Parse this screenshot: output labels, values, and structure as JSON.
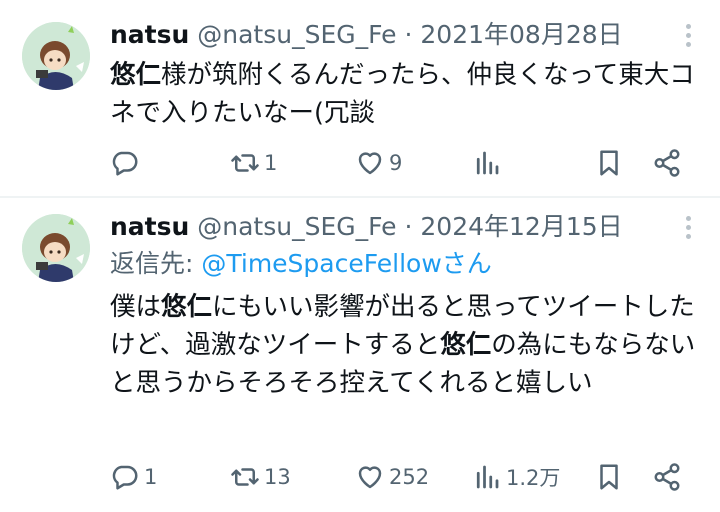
{
  "tweets": [
    {
      "author_name": "natsu",
      "handle": "@natsu_SEG_Fe",
      "separator": "·",
      "date": "2021年08月28日",
      "reply_to": null,
      "body_segments": [
        {
          "text": "悠仁",
          "bold": true
        },
        {
          "text": "様が筑附くるんだったら、仲良くなって東大コネで入りたいなー(冗談",
          "bold": false
        }
      ],
      "replies": "",
      "reposts": "1",
      "likes": "9",
      "views": ""
    },
    {
      "author_name": "natsu",
      "handle": "@natsu_SEG_Fe",
      "separator": "·",
      "date": "2024年12月15日",
      "reply_to": {
        "prefix": "返信先: ",
        "user": "@TimeSpaceFellow",
        "suffix": "さん"
      },
      "body_segments": [
        {
          "text": "僕は",
          "bold": false
        },
        {
          "text": "悠仁",
          "bold": true
        },
        {
          "text": "にもいい影響が出ると思ってツイートしたけど、過激なツイートすると",
          "bold": false
        },
        {
          "text": "悠仁",
          "bold": true
        },
        {
          "text": "の為にもならないと思うからそろそろ控えてくれると嬉しい",
          "bold": false
        }
      ],
      "replies": "1",
      "reposts": "13",
      "likes": "252",
      "views": "1.2万"
    }
  ],
  "colors": {
    "text": "#0f1419",
    "secondary": "#536471",
    "link": "#1d9bf0",
    "divider": "#eff3f4"
  }
}
